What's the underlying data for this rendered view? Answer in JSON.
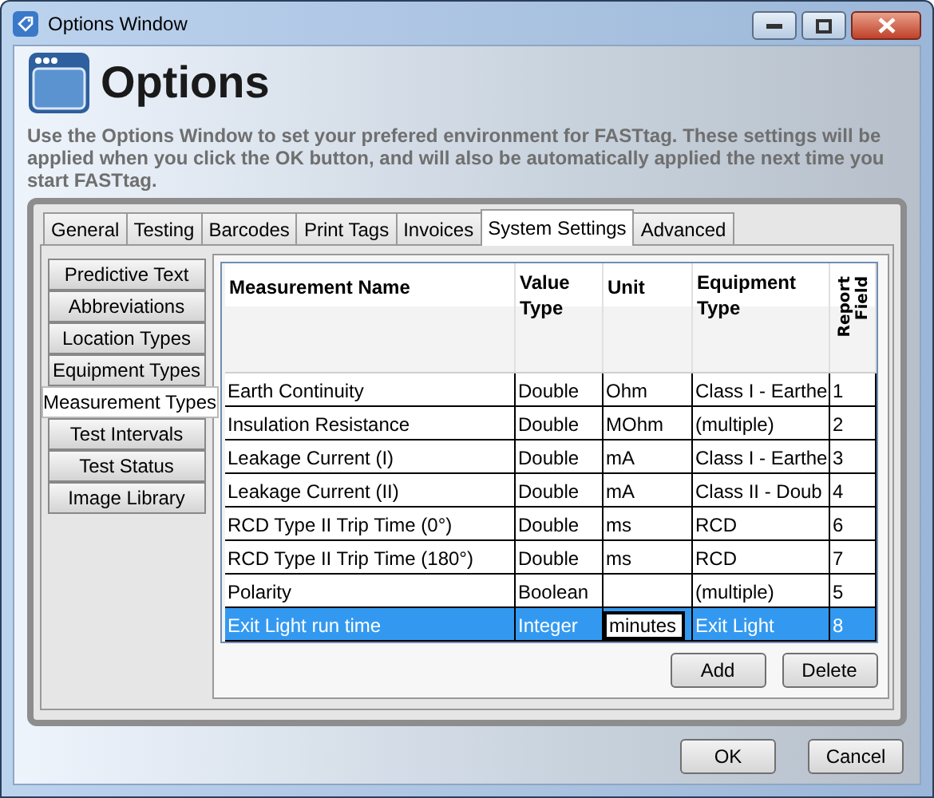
{
  "window": {
    "title": "Options Window"
  },
  "header": {
    "title": "Options",
    "description": "Use the Options Window to set your prefered environment for FASTtag. These settings will be applied when you click the OK button, and will also be automatically applied the next time you start FASTtag."
  },
  "tabs": [
    {
      "label": "General",
      "selected": false
    },
    {
      "label": "Testing",
      "selected": false
    },
    {
      "label": "Barcodes",
      "selected": false
    },
    {
      "label": "Print Tags",
      "selected": false
    },
    {
      "label": "Invoices",
      "selected": false
    },
    {
      "label": "System Settings",
      "selected": true
    },
    {
      "label": "Advanced",
      "selected": false
    }
  ],
  "sidebar": {
    "items": [
      {
        "label": "Predictive Text",
        "selected": false
      },
      {
        "label": "Abbreviations",
        "selected": false
      },
      {
        "label": "Location Types",
        "selected": false
      },
      {
        "label": "Equipment Types",
        "selected": false
      },
      {
        "label": "Measurement Types",
        "selected": true
      },
      {
        "label": "Test Intervals",
        "selected": false
      },
      {
        "label": "Test Status",
        "selected": false
      },
      {
        "label": "Image Library",
        "selected": false
      }
    ]
  },
  "table": {
    "columns": [
      "Measurement Name",
      "Value Type",
      "Unit",
      "Equipment Type",
      "Report Field"
    ],
    "rows": [
      {
        "cells": [
          "Earth Continuity",
          "Double",
          "Ohm",
          "Class I - Earthe",
          "1"
        ],
        "selected": false,
        "editing": false
      },
      {
        "cells": [
          "Insulation Resistance",
          "Double",
          "MOhm",
          "(multiple)",
          "2"
        ],
        "selected": false,
        "editing": false
      },
      {
        "cells": [
          "Leakage Current (I)",
          "Double",
          "mA",
          "Class I - Earthe",
          "3"
        ],
        "selected": false,
        "editing": false
      },
      {
        "cells": [
          "Leakage Current (II)",
          "Double",
          "mA",
          "Class II - Doub",
          "4"
        ],
        "selected": false,
        "editing": false
      },
      {
        "cells": [
          "RCD Type II Trip Time (0°)",
          "Double",
          "ms",
          "RCD",
          "6"
        ],
        "selected": false,
        "editing": false
      },
      {
        "cells": [
          "RCD Type II Trip Time (180°)",
          "Double",
          "ms",
          "RCD",
          "7"
        ],
        "selected": false,
        "editing": false
      },
      {
        "cells": [
          "Polarity",
          "Boolean",
          "",
          "(multiple)",
          "5"
        ],
        "selected": false,
        "editing": false
      },
      {
        "cells": [
          "Exit Light run time",
          "Integer",
          "minutes",
          "Exit Light",
          "8"
        ],
        "selected": true,
        "editing": true
      }
    ]
  },
  "table_buttons": [
    "Add",
    "Delete"
  ],
  "buttons": [
    "OK",
    "Cancel"
  ]
}
